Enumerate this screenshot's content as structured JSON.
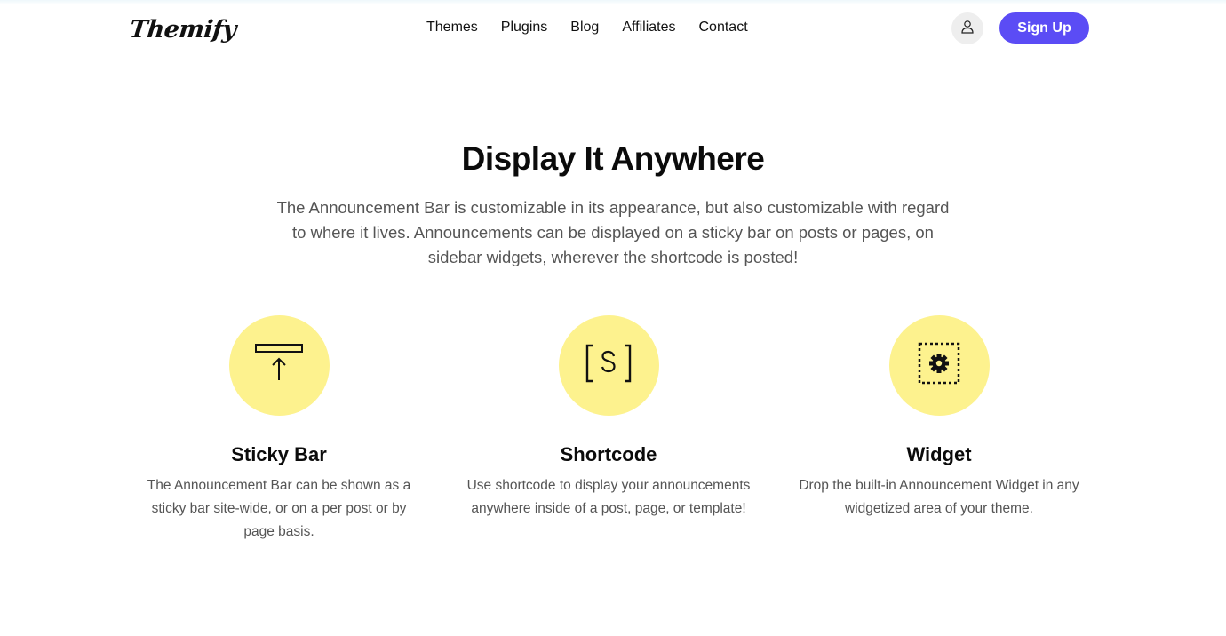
{
  "header": {
    "logo": "Themify",
    "nav": [
      "Themes",
      "Plugins",
      "Blog",
      "Affiliates",
      "Contact"
    ],
    "account_icon": "user-icon",
    "signup_label": "Sign Up",
    "accent_color": "#5b4cf5"
  },
  "section": {
    "title": "Display It Anywhere",
    "description": "The Announcement Bar is customizable in its appearance, but also customizable with regard to where it lives. Announcements can be displayed on a sticky bar on posts or pages, on sidebar widgets, wherever the shortcode is posted!"
  },
  "features": [
    {
      "icon": "sticky-bar-icon",
      "title": "Sticky Bar",
      "text": "The Announcement Bar can be shown as a sticky bar site-wide, or on a per post or by page basis."
    },
    {
      "icon": "shortcode-icon",
      "title": "Shortcode",
      "text": "Use shortcode to display your announcements anywhere inside of a post, page, or template!"
    },
    {
      "icon": "widget-icon",
      "title": "Widget",
      "text": "Drop the built-in Announcement Widget in any widgetized area of your theme."
    }
  ],
  "colors": {
    "icon_circle": "#fdf28e",
    "body_text": "#555555"
  }
}
